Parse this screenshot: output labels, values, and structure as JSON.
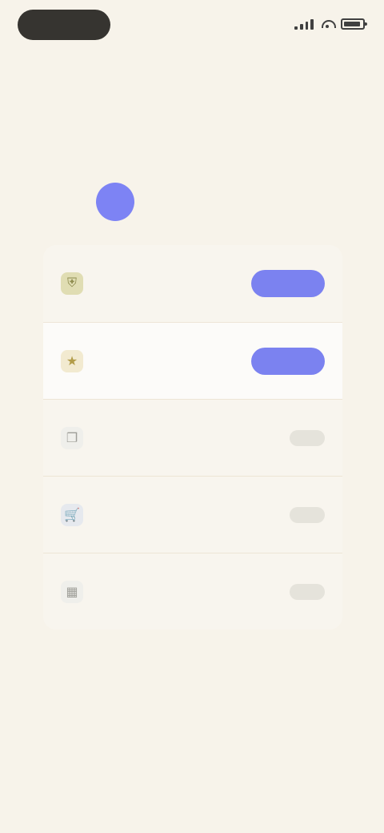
{
  "status_bar": {
    "time": "",
    "icons": [
      "signal-icon",
      "wifi-icon",
      "battery-icon"
    ]
  },
  "headline": {
    "line1": "",
    "line2": ""
  },
  "account": {
    "avatar_text": "",
    "name": ""
  },
  "options": [
    {
      "icon": "shield-icon",
      "label": "",
      "action_label": ""
    },
    {
      "icon": "star-icon",
      "label": "",
      "action_label": ""
    },
    {
      "icon": "copy-icon",
      "label": "",
      "meta": ""
    },
    {
      "icon": "cart-icon",
      "label": "",
      "meta": ""
    },
    {
      "icon": "calendar-icon",
      "label": "",
      "meta": ""
    }
  ],
  "colors": {
    "background": "#f7f3ea",
    "accent": "#7b82f0",
    "dark": "#363430"
  }
}
